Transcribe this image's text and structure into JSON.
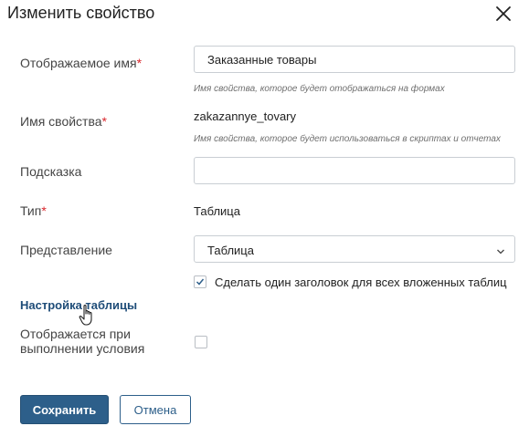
{
  "dialog": {
    "title": "Изменить свойство"
  },
  "fields": {
    "display_name": {
      "label": "Отображаемое имя",
      "required_mark": "*",
      "value": "Заказанные товары",
      "hint": "Имя свойства, которое будет отображаться на формах"
    },
    "property_name": {
      "label": "Имя свойства",
      "required_mark": "*",
      "value": "zakazannye_tovary",
      "hint": "Имя свойства, которое будет использоваться в скриптах и отчетах"
    },
    "tooltip": {
      "label": "Подсказка",
      "value": ""
    },
    "type": {
      "label": "Тип",
      "required_mark": "*",
      "value": "Таблица"
    },
    "view": {
      "label": "Представление",
      "selected": "Таблица",
      "single_header_checked": true,
      "single_header_label": "Сделать один заголовок для всех вложенных таблиц"
    },
    "conditional_display": {
      "label_line1": "Отображается при",
      "label_line2": "выполнении условия",
      "checked": false
    }
  },
  "table_settings_link": "Настройка таблицы",
  "buttons": {
    "save": "Сохранить",
    "cancel": "Отмена"
  },
  "colors": {
    "primary": "#2d5f8a",
    "link": "#1e4c78",
    "required": "#d9262c"
  }
}
